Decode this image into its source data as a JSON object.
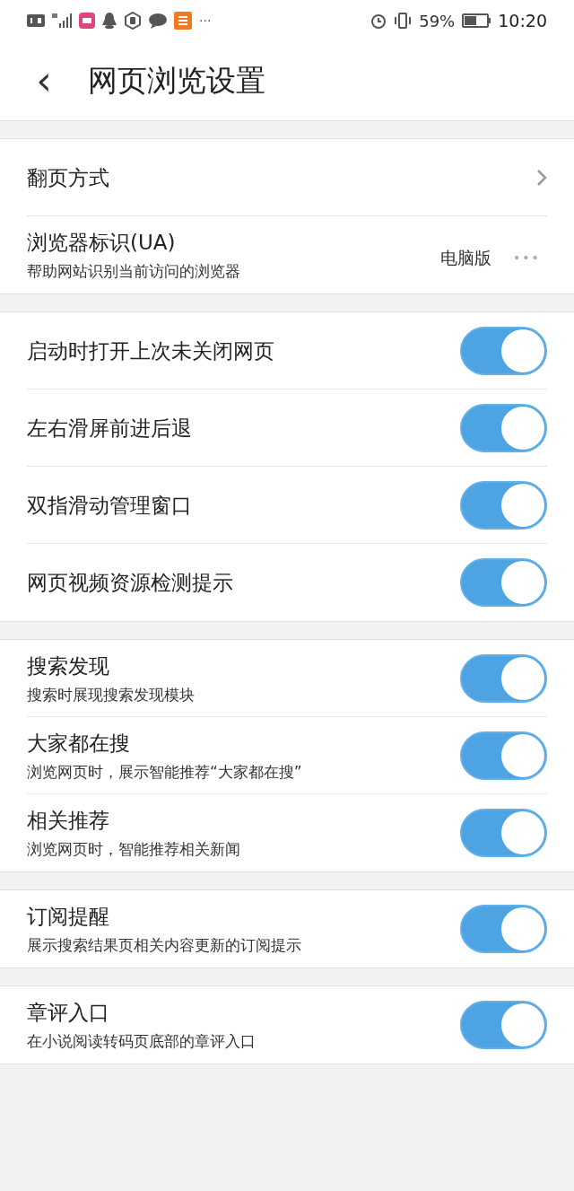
{
  "status_bar": {
    "more": "···",
    "battery_percent": "59%",
    "time": "10:20"
  },
  "header": {
    "back": "‹",
    "title": "网页浏览设置"
  },
  "sections": [
    {
      "rows": [
        {
          "kind": "link",
          "label": "翻页方式"
        },
        {
          "kind": "option",
          "label": "浏览器标识(UA)",
          "subtitle": "帮助网站识别当前访问的浏览器",
          "value": "电脑版",
          "more": "•••"
        }
      ]
    },
    {
      "rows": [
        {
          "kind": "toggle",
          "label": "启动时打开上次未关闭网页",
          "on": true
        },
        {
          "kind": "toggle",
          "label": "左右滑屏前进后退",
          "on": true
        },
        {
          "kind": "toggle",
          "label": "双指滑动管理窗口",
          "on": true
        },
        {
          "kind": "toggle",
          "label": "网页视频资源检测提示",
          "on": true
        }
      ]
    },
    {
      "rows": [
        {
          "kind": "toggle",
          "label": "搜索发现",
          "subtitle": "搜索时展现搜索发现模块",
          "on": true
        },
        {
          "kind": "toggle",
          "label": "大家都在搜",
          "subtitle": "浏览网页时，展示智能推荐“大家都在搜”",
          "on": true
        },
        {
          "kind": "toggle",
          "label": "相关推荐",
          "subtitle": "浏览网页时，智能推荐相关新闻",
          "on": true
        }
      ]
    },
    {
      "rows": [
        {
          "kind": "toggle",
          "label": "订阅提醒",
          "subtitle": "展示搜索结果页相关内容更新的订阅提示",
          "on": true
        }
      ]
    },
    {
      "rows": [
        {
          "kind": "toggle",
          "label": "章评入口",
          "subtitle": "在小说阅读转码页底部的章评入口",
          "on": true
        }
      ]
    }
  ]
}
